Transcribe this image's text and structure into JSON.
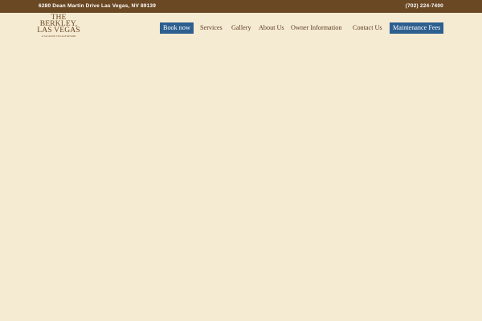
{
  "topbar": {
    "address": "6280 Dean Martin Drive Las Vegas, NV 89139",
    "phone": "(702) 224-7400"
  },
  "logo": {
    "line1": "THE",
    "line2": "BERKLEY,",
    "line3": "LAS VEGAS",
    "tagline": "A VACATION VILLAGE RESORT"
  },
  "nav": {
    "book_now": "Book now",
    "services": "Services",
    "gallery": "Gallery",
    "about_us": "About Us",
    "owner_information": "Owner Information",
    "contact_us": "Contact Us",
    "maintenance_fees": "Maintenance Fees"
  },
  "colors": {
    "topbar_bg": "#6b4824",
    "page_bg": "#f5ead2",
    "button_bg": "#2d5f8f",
    "nav_text": "#5a3e22"
  }
}
